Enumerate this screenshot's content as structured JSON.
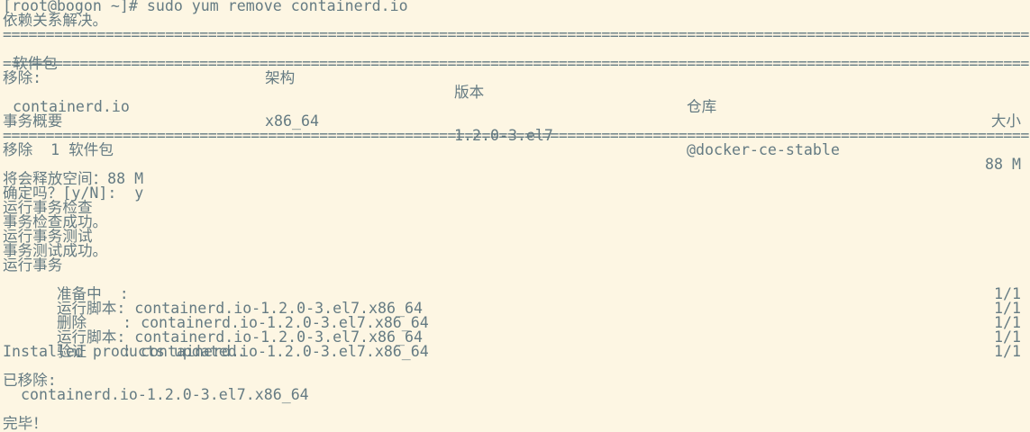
{
  "terminal": {
    "separator_char": "=",
    "prompt_line": "[root@bogon ~]# sudo yum remove containerd.io",
    "deps_resolved": "依赖关系解决。",
    "table": {
      "headers": {
        "package": "软件包",
        "arch": "架构",
        "version": "版本",
        "repo": "仓库",
        "size": "大小"
      },
      "section_label": "移除:",
      "rows": [
        {
          "package": "containerd.io",
          "arch": "x86_64",
          "version": "1.2.0-3.el7",
          "repo": "@docker-ce-stable",
          "size": "88 M"
        }
      ]
    },
    "summary_title": "事务概要",
    "summary_line": "移除  1 软件包",
    "free_space": "将会释放空间：88 M",
    "confirm": "确定吗？[y/N]:  y",
    "steps": [
      "运行事务检查",
      "事务检查成功。",
      "运行事务测试",
      "事务测试成功。",
      "运行事务"
    ],
    "progress": [
      {
        "label": "  准备中  : ",
        "count": "1/1"
      },
      {
        "label": "  运行脚本: containerd.io-1.2.0-3.el7.x86_64",
        "count": "1/1"
      },
      {
        "label": "  删除    : containerd.io-1.2.0-3.el7.x86_64",
        "count": "1/1"
      },
      {
        "label": "  运行脚本: containerd.io-1.2.0-3.el7.x86_64",
        "count": "1/1"
      },
      {
        "label": "  验证    : containerd.io-1.2.0-3.el7.x86_64",
        "count": "1/1"
      }
    ],
    "installed_products": "Installed products updated.",
    "removed_title": "已移除:",
    "removed_item": "  containerd.io-1.2.0-3.el7.x86_64",
    "done": "完毕！"
  }
}
